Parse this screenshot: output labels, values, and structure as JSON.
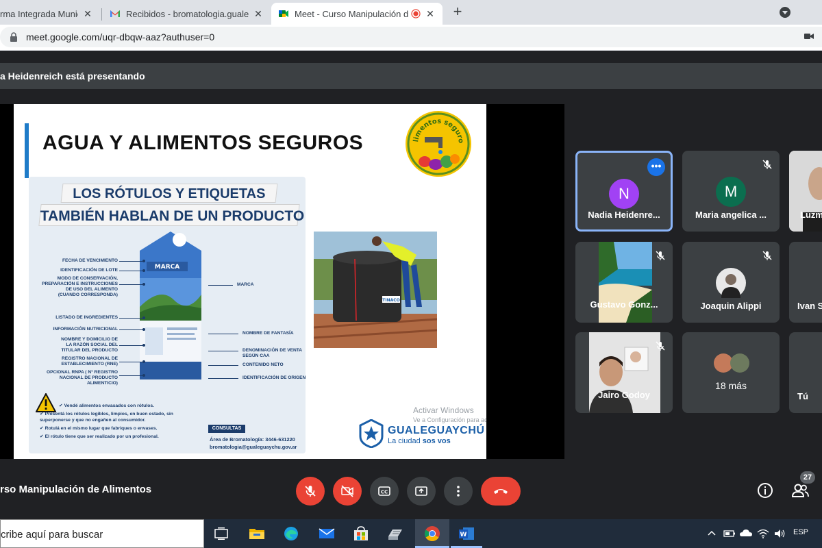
{
  "browser": {
    "tabs": [
      {
        "title": "rma Integrada Munici",
        "favicon": "portal-icon"
      },
      {
        "title": "Recibidos - bromatologia.gualeg",
        "favicon": "gmail-icon"
      },
      {
        "title": "Meet - Curso Manipulación d",
        "favicon": "meet-icon",
        "recording": true
      }
    ],
    "url": "meet.google.com/uqr-dbqw-aaz?authuser=0"
  },
  "meet": {
    "presenter_banner": "a Heidenreich está presentando",
    "meeting_title": "rso Manipulación de Alimentos",
    "participants_count": "27"
  },
  "slide": {
    "title": "AGUA Y ALIMENTOS SEGUROS",
    "logo_text": "Alimentos seguros",
    "banner_line1": "LOS RÓTULOS Y ETIQUETAS",
    "banner_line2": "TAMBIÉN HABLAN DE UN PRODUCTO",
    "carton_brand": "MARCA",
    "labels_left": [
      "FECHA DE VENCIMIENTO",
      "IDENTIFICACIÓN DE LOTE",
      "MODO DE CONSERVACIÓN,",
      "PREPARACIÓN E INSTRUCCIONES",
      "DE USO DEL ALIMENTO",
      "(CUANDO CORRESPONDA)",
      "LISTADO DE INGREDIENTES",
      "INFORMACIÓN NUTRICIONAL",
      "NOMBRE Y DOMICILIO DE",
      "LA RAZÓN SOCIAL DEL",
      "TITULAR DEL PRODUCTO",
      "REGISTRO NACIONAL DE",
      "ESTABLECIMIENTO (RNE)",
      "OPCIONAL RNPA ( N° REGISTRO",
      "NACIONAL DE PRODUCTO",
      "ALIMENTICIO)"
    ],
    "labels_right": [
      "MARCA",
      "NOMBRE DE FANTASÍA",
      "DENOMINACIÓN DE VENTA",
      "SEGÚN CAA",
      "CONTENIDO NETO",
      "IDENTIFICACIÓN DE ORIGEN"
    ],
    "bullets": [
      "Vendé alimentos envasados con rótulos.",
      "Presentá los rótulos legibles, limpios, en buen estado, sin superponerse y que no engañen al consumidor.",
      "Rotulá en el mismo lugar que fabriques o envases.",
      "El rótulo tiene que ser realizado por un profesional."
    ],
    "consultas_badge": "CONSULTAS",
    "consultas_line1": "Área de Bromatología: 3446-631220",
    "consultas_line2": "bromatologia@gualeguaychu.gov.ar",
    "watermark_line1": "Activar Windows",
    "watermark_line2": "Ve a Configuración para activar Windows.",
    "muni_name": "GUALEGUAYCHÚ",
    "muni_tag_prefix": "La ciudad ",
    "muni_tag_bold": "sos vos",
    "tank_brand": "TINACO"
  },
  "participants": [
    {
      "name": "Nadia Heidenre...",
      "initial": "N",
      "avatar_color": "#a142f4",
      "speaking": true
    },
    {
      "name": "Maria angelica ...",
      "initial": "M",
      "avatar_color": "#0b6e4f",
      "muted": true
    },
    {
      "name": "Luzm",
      "muted": false
    },
    {
      "name": "Gustavo Gonz...",
      "muted": true
    },
    {
      "name": "Joaquin Alippi",
      "muted": true
    },
    {
      "name": "Ivan S"
    },
    {
      "name": "Jairo Godoy",
      "muted": true
    },
    {
      "name": "18 más"
    },
    {
      "name": "Tú"
    }
  ],
  "taskbar": {
    "search_placeholder": "cribe aquí para buscar",
    "language": "ESP"
  },
  "colors": {
    "meet_bg": "#202124",
    "tile_bg": "#3c4043",
    "hangup_red": "#ea4335",
    "speaking_outline": "#8ab4f8",
    "slide_navy": "#1b3c6b",
    "slide_blue": "#1e7bc8"
  }
}
